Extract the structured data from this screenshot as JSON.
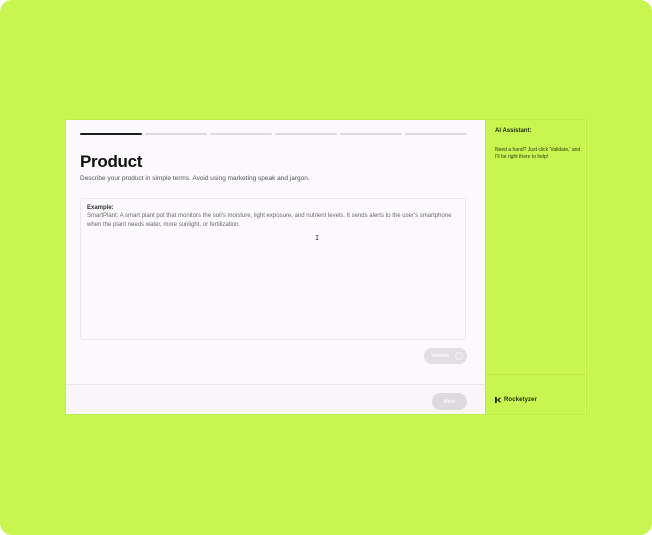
{
  "steps": {
    "total": 6,
    "active_index": 0
  },
  "page": {
    "title": "Product",
    "subtitle": "Describe your product in simple terms. Avoid using marketing speak and jargon."
  },
  "input": {
    "example_label": "Example:",
    "example_text": "SmartPlant: A smart plant pot that monitors the soil's moisture, light exposure, and nutrient levels. It sends alerts to the user's smartphone when the plant needs water, more sunlight, or fertilization."
  },
  "buttons": {
    "validate": "Validate",
    "next": "Next"
  },
  "assistant": {
    "heading": "AI Assistant:",
    "message": "Need a hand? Just click 'Validate,' and I'll be right there to help!"
  },
  "brand": {
    "name": "Rocketyzer"
  },
  "colors": {
    "accent": "#c8f550",
    "progress_active": "#1d1d1f",
    "progress_inactive": "#dedbe0"
  }
}
